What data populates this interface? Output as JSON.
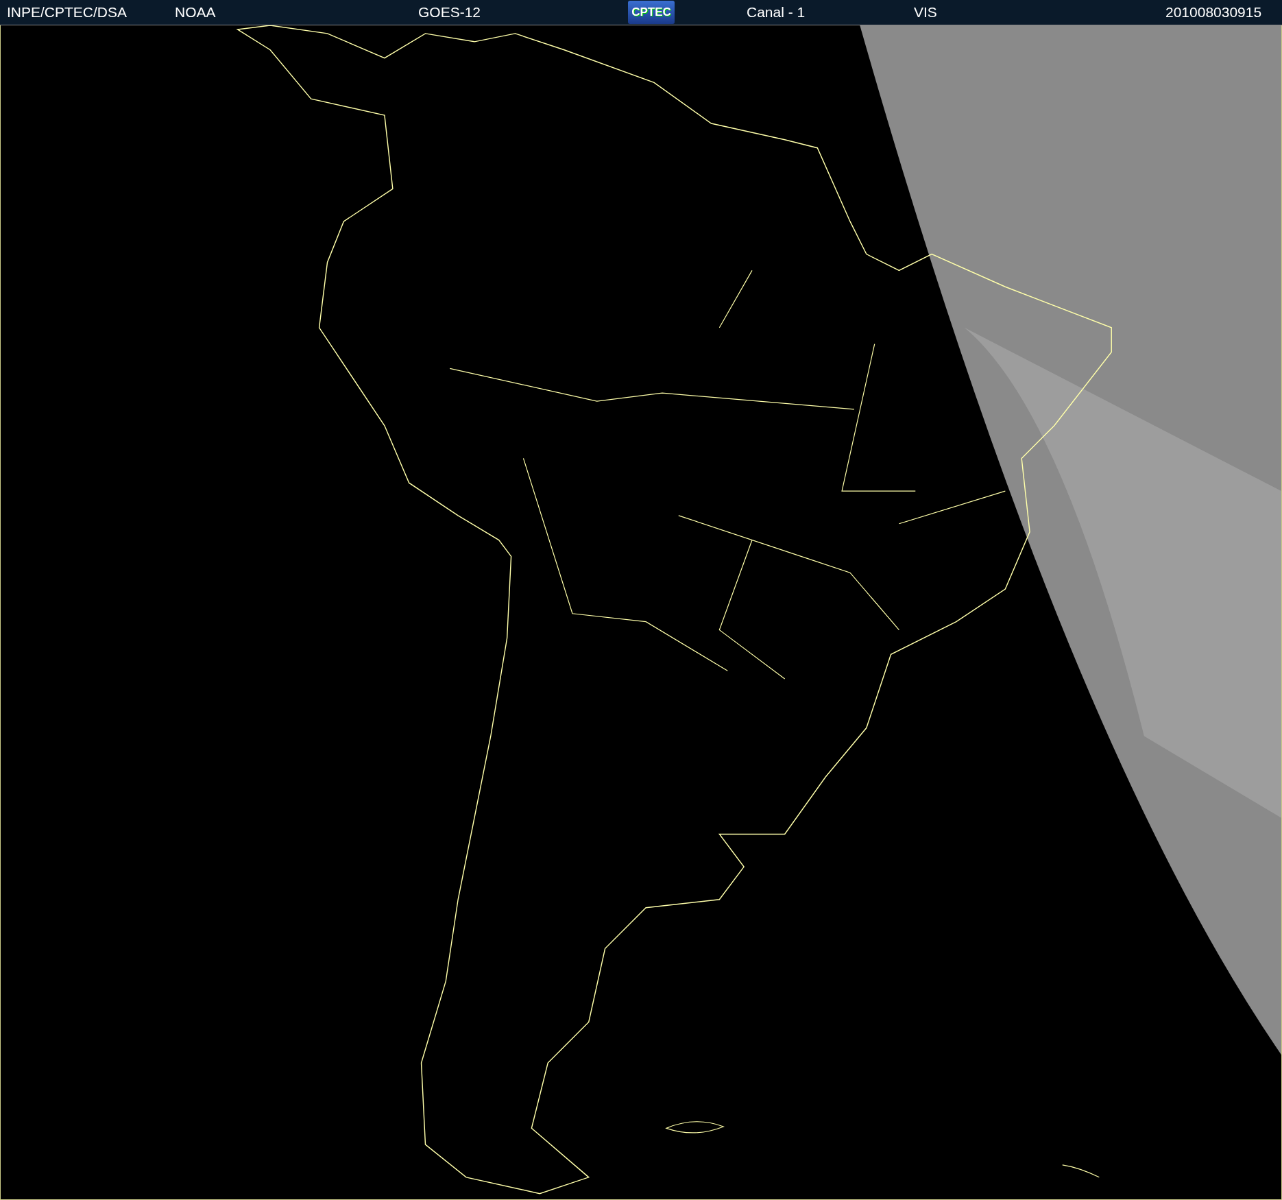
{
  "header": {
    "items": [
      {
        "kind": "text",
        "text": "INPE/CPTEC/DSA"
      },
      {
        "kind": "text",
        "text": "NOAA"
      },
      {
        "kind": "text",
        "text": "GOES-12"
      },
      {
        "kind": "logo",
        "text": "CPTEC"
      },
      {
        "kind": "text",
        "text": "Canal - 1"
      },
      {
        "kind": "text",
        "text": "VIS"
      },
      {
        "kind": "text",
        "text": "201008030915"
      }
    ]
  }
}
